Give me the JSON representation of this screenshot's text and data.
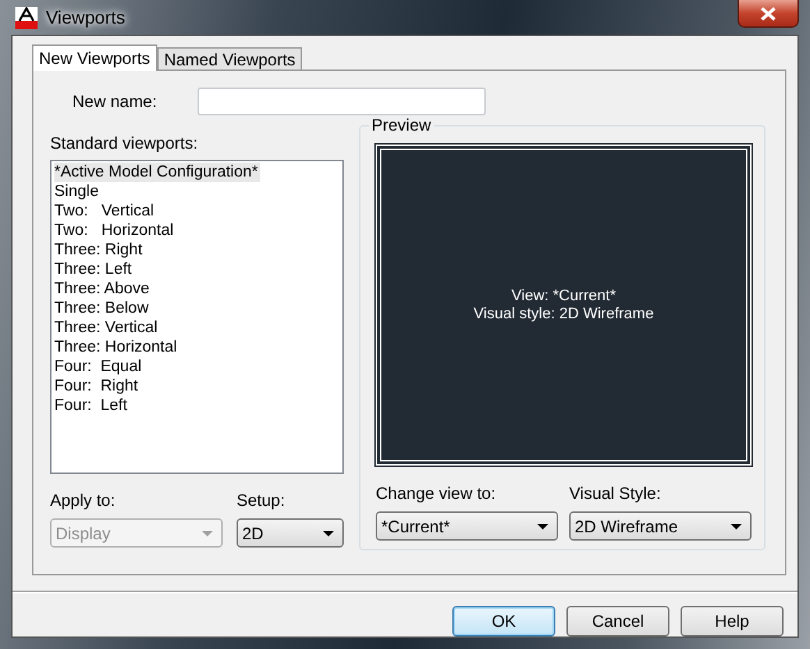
{
  "window": {
    "title": "Viewports"
  },
  "tabs": [
    {
      "label": "New Viewports",
      "selected": true
    },
    {
      "label": "Named Viewports",
      "selected": false
    }
  ],
  "new_name": {
    "label": "New name:"
  },
  "standard_viewports": {
    "label": "Standard viewports:",
    "items": [
      {
        "label": "*Active Model Configuration*",
        "selected": true
      },
      {
        "label": "Single",
        "selected": false
      },
      {
        "label": "Two:   Vertical",
        "selected": false
      },
      {
        "label": "Two:   Horizontal",
        "selected": false
      },
      {
        "label": "Three: Right",
        "selected": false
      },
      {
        "label": "Three: Left",
        "selected": false
      },
      {
        "label": "Three: Above",
        "selected": false
      },
      {
        "label": "Three: Below",
        "selected": false
      },
      {
        "label": "Three: Vertical",
        "selected": false
      },
      {
        "label": "Three: Horizontal",
        "selected": false
      },
      {
        "label": "Four:  Equal",
        "selected": false
      },
      {
        "label": "Four:  Right",
        "selected": false
      },
      {
        "label": "Four:  Left",
        "selected": false
      }
    ]
  },
  "preview": {
    "title": "Preview",
    "lines": [
      "View: *Current*",
      "Visual style: 2D Wireframe"
    ]
  },
  "dropdowns": [
    {
      "label": "Apply to:",
      "value": "Display",
      "disabled": true
    },
    {
      "label": "Setup:",
      "value": "2D",
      "disabled": false
    },
    {
      "label": "Change view to:",
      "value": "*Current*",
      "disabled": false
    },
    {
      "label": "Visual Style:",
      "value": "2D Wireframe",
      "disabled": false
    }
  ],
  "buttons": [
    {
      "label": "OK",
      "default": true
    },
    {
      "label": "Cancel",
      "default": false
    },
    {
      "label": "Help",
      "default": false
    }
  ]
}
